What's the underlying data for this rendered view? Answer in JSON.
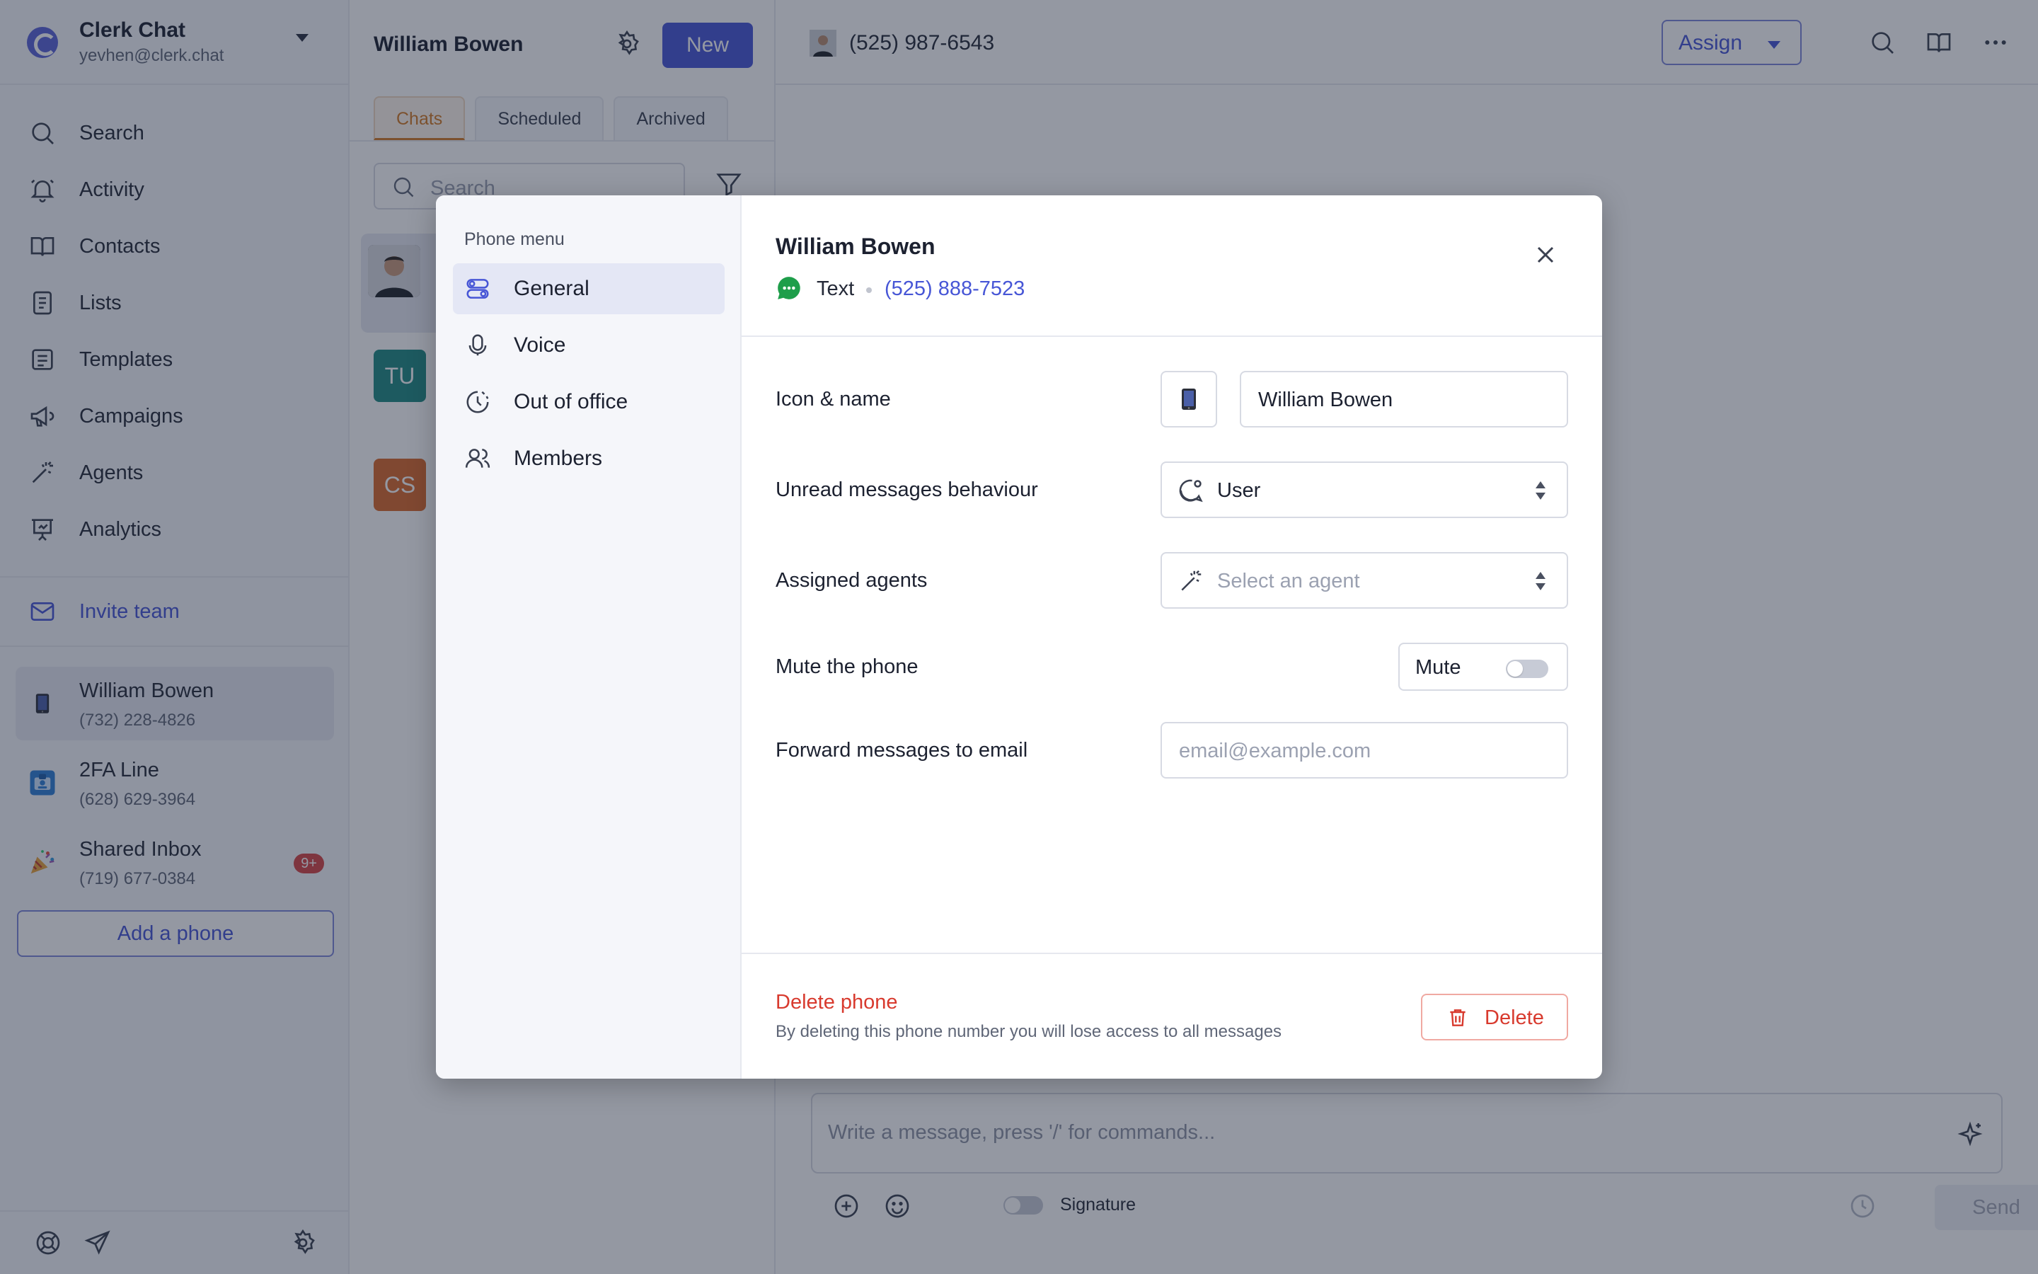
{
  "workspace": {
    "name": "Clerk Chat",
    "email": "yevhen@clerk.chat"
  },
  "nav": {
    "items": [
      {
        "label": "Search",
        "icon": "search-icon"
      },
      {
        "label": "Activity",
        "icon": "bell-icon"
      },
      {
        "label": "Contacts",
        "icon": "book-icon"
      },
      {
        "label": "Lists",
        "icon": "list-icon"
      },
      {
        "label": "Templates",
        "icon": "template-icon"
      },
      {
        "label": "Campaigns",
        "icon": "megaphone-icon"
      },
      {
        "label": "Agents",
        "icon": "magic-wand-icon"
      },
      {
        "label": "Analytics",
        "icon": "presentation-chart-icon"
      }
    ],
    "invite_label": "Invite team"
  },
  "phones": [
    {
      "name": "William Bowen",
      "number": "(732) 228-4826",
      "icon": "mobile-phone-icon"
    },
    {
      "name": "2FA Line",
      "number": "(628) 629-3964",
      "icon": "id-card-icon"
    },
    {
      "name": "Shared Inbox",
      "number": "(719) 677-0384",
      "icon": "party-popper-icon",
      "badge": "9+"
    }
  ],
  "add_phone_label": "Add a phone",
  "chats": {
    "title": "William Bowen",
    "new_label": "New",
    "tabs": [
      "Chats",
      "Scheduled",
      "Archived"
    ],
    "search_placeholder": "Search",
    "avatars": [
      {
        "initials": "TU",
        "color": "#1f8a82"
      },
      {
        "initials": "CS",
        "color": "#d9692a"
      }
    ]
  },
  "conversation": {
    "phone": "(525) 987-6543",
    "assign_label": "Assign",
    "composer_placeholder": "Write a message, press '/' for commands...",
    "signature_label": "Signature",
    "send_label": "Send"
  },
  "modal": {
    "menu_title": "Phone menu",
    "menu": [
      {
        "label": "General",
        "icon": "toggles-icon"
      },
      {
        "label": "Voice",
        "icon": "microphone-icon"
      },
      {
        "label": "Out of office",
        "icon": "clock-icon"
      },
      {
        "label": "Members",
        "icon": "users-icon"
      }
    ],
    "title": "William Bowen",
    "channel": "Text",
    "number": "(525) 888-7523",
    "fields": {
      "icon_name_label": "Icon & name",
      "icon": "mobile-phone-icon",
      "name_value": "William Bowen",
      "unread_label": "Unread messages behaviour",
      "unread_value": "User",
      "agents_label": "Assigned agents",
      "agents_placeholder": "Select an agent",
      "mute_label": "Mute the phone",
      "mute_toggle_label": "Mute",
      "mute_on": false,
      "forward_label": "Forward messages to email",
      "forward_placeholder": "email@example.com"
    },
    "delete": {
      "title": "Delete phone",
      "description": "By deleting this phone number you will lose access to all messages",
      "button_label": "Delete"
    }
  },
  "colors": {
    "accent": "#4756d6",
    "danger": "#d83a2e",
    "chats_tab_active": "#d27a25",
    "text_channel": "#1e9e4a"
  }
}
